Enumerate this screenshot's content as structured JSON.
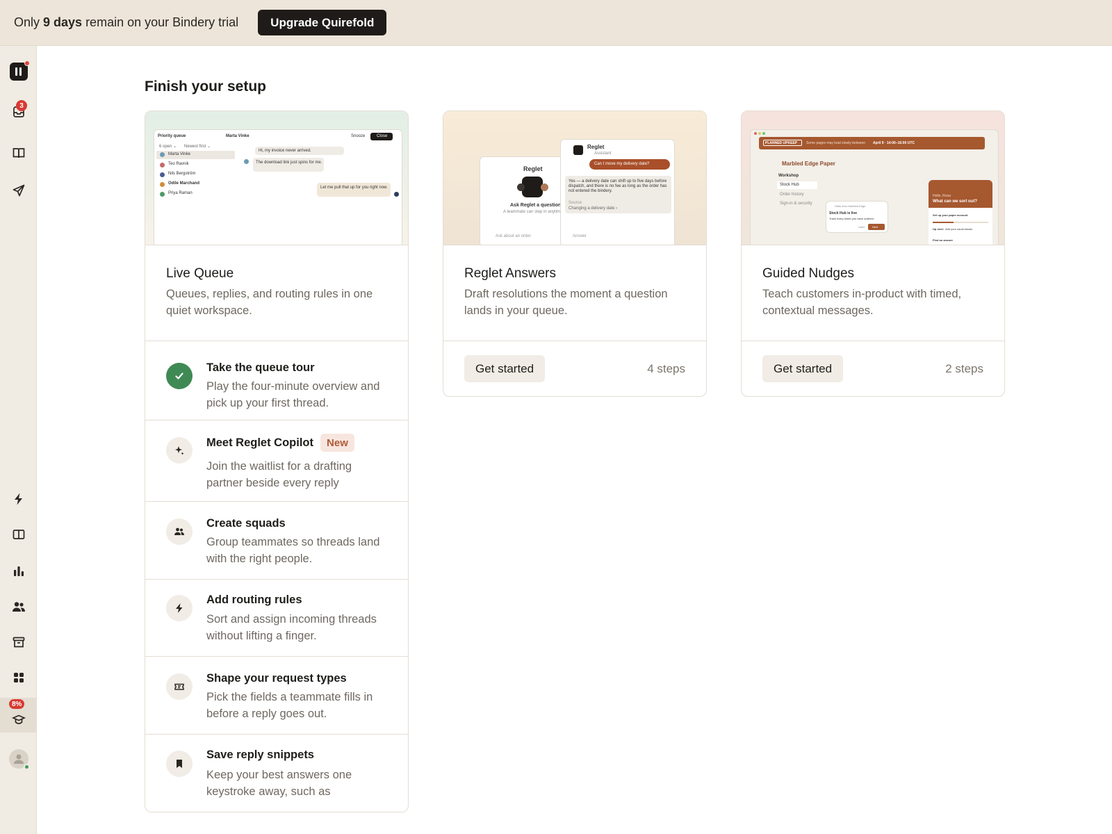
{
  "banner": {
    "prefix": "Only ",
    "days": "9 days",
    "suffix": " remain on your Bindery trial",
    "upgrade_label": "Upgrade Quirefold"
  },
  "sidebar": {
    "inbox_badge": "3",
    "progress_badge": "8%",
    "items": [
      {
        "name": "logo",
        "icon": "logo-icon"
      },
      {
        "name": "inbox",
        "icon": "inbox-icon"
      },
      {
        "name": "knowledge",
        "icon": "book-icon"
      },
      {
        "name": "outbound",
        "icon": "send-icon"
      },
      {
        "name": "automation",
        "icon": "lightning-icon"
      },
      {
        "name": "articles",
        "icon": "book-open-icon"
      },
      {
        "name": "reports",
        "icon": "bar-chart-icon"
      },
      {
        "name": "contacts",
        "icon": "people-icon"
      },
      {
        "name": "archive",
        "icon": "archive-icon"
      },
      {
        "name": "apps",
        "icon": "grid-icon"
      },
      {
        "name": "onboarding",
        "icon": "graduation-cap-icon"
      },
      {
        "name": "profile",
        "icon": "avatar-icon"
      }
    ]
  },
  "main": {
    "title": "Finish your setup",
    "cards": [
      {
        "title": "Live Queue",
        "desc": "Queues, replies, and routing rules in one quiet workspace.",
        "mock": {
          "queue_label": "Priority queue",
          "open_filter": "6 open ⌄",
          "sort_filter": "Newest first ⌄",
          "contact": "Marta Vinke",
          "snooze": "Snooze",
          "close": "Close",
          "rows": [
            "Marta Vinke",
            "Teo Ravnik",
            "Nils Bergström",
            "Odile Marchand",
            "Priya Raman"
          ],
          "msg1": "Hi, my invoice never arrived.",
          "msg2": "The download link just spins for me.",
          "reply": "Let me pull that up for you right now."
        }
      },
      {
        "title": "Reglet Answers",
        "desc": "Draft resolutions the moment a question lands in your queue.",
        "button": "Get started",
        "steps": "4 steps",
        "mock": {
          "brand": "Reglet",
          "ask": "Ask Reglet a question",
          "sub": "A teammate can step in anytime",
          "input": "Ask about an order",
          "assistant": "Assistant",
          "question": "Can I move my delivery date?",
          "answer": "Yes — a delivery date can shift up to five days before dispatch, and there is no fee as long as the order has not entered the bindery.",
          "source_label": "Source",
          "source": "Changing a delivery date ›",
          "answer_label": "Answer"
        }
      },
      {
        "title": "Guided Nudges",
        "desc": "Teach customers in-product with timed, contextual messages.",
        "button": "Get started",
        "steps": "2 steps",
        "mock": {
          "notice_tag": "PLANNED UPKEEP",
          "notice": "Some pages may load slowly between",
          "notice_time": "April 9 · 14:00–16:00 UTC",
          "brand": "Marbled Edge Paper",
          "nav": [
            "Workshop",
            "Stock Hub",
            "Order history",
            "Sign-in & security"
          ],
          "popup_from": "Odile from Marbled Edge",
          "popup_title": "Stock Hub is live",
          "popup_body": "Track every sheet you have ordered",
          "popup_btn": "Next",
          "popup_later": "Later",
          "greet": "Hello, Rosa",
          "greet_q": "What can we sort out?",
          "setup": "Set up your paper account",
          "upnext": "Up next:",
          "upnext_item": "Add your usual stocks",
          "find": "Find an answer"
        }
      }
    ],
    "tasks": [
      {
        "title": "Take the queue tour",
        "desc": "Play the four-minute overview and pick up your first thread.",
        "icon": "check-icon",
        "done": true
      },
      {
        "title": "Meet Reglet Copilot",
        "badge": "New",
        "desc": "Join the waitlist for a drafting partner beside every reply",
        "icon": "sparkle-icon"
      },
      {
        "title": "Create squads",
        "desc": "Group teammates so threads land with the right people.",
        "icon": "people-icon"
      },
      {
        "title": "Add routing rules",
        "desc": "Sort and assign incoming threads without lifting a finger.",
        "icon": "lightning-icon"
      },
      {
        "title": "Shape your request types",
        "desc": "Pick the fields a teammate fills in before a reply goes out.",
        "icon": "ticket-icon"
      },
      {
        "title": "Save reply snippets",
        "desc": "Keep your best answers one keystroke away, such as",
        "icon": "bookmark-icon"
      }
    ]
  }
}
